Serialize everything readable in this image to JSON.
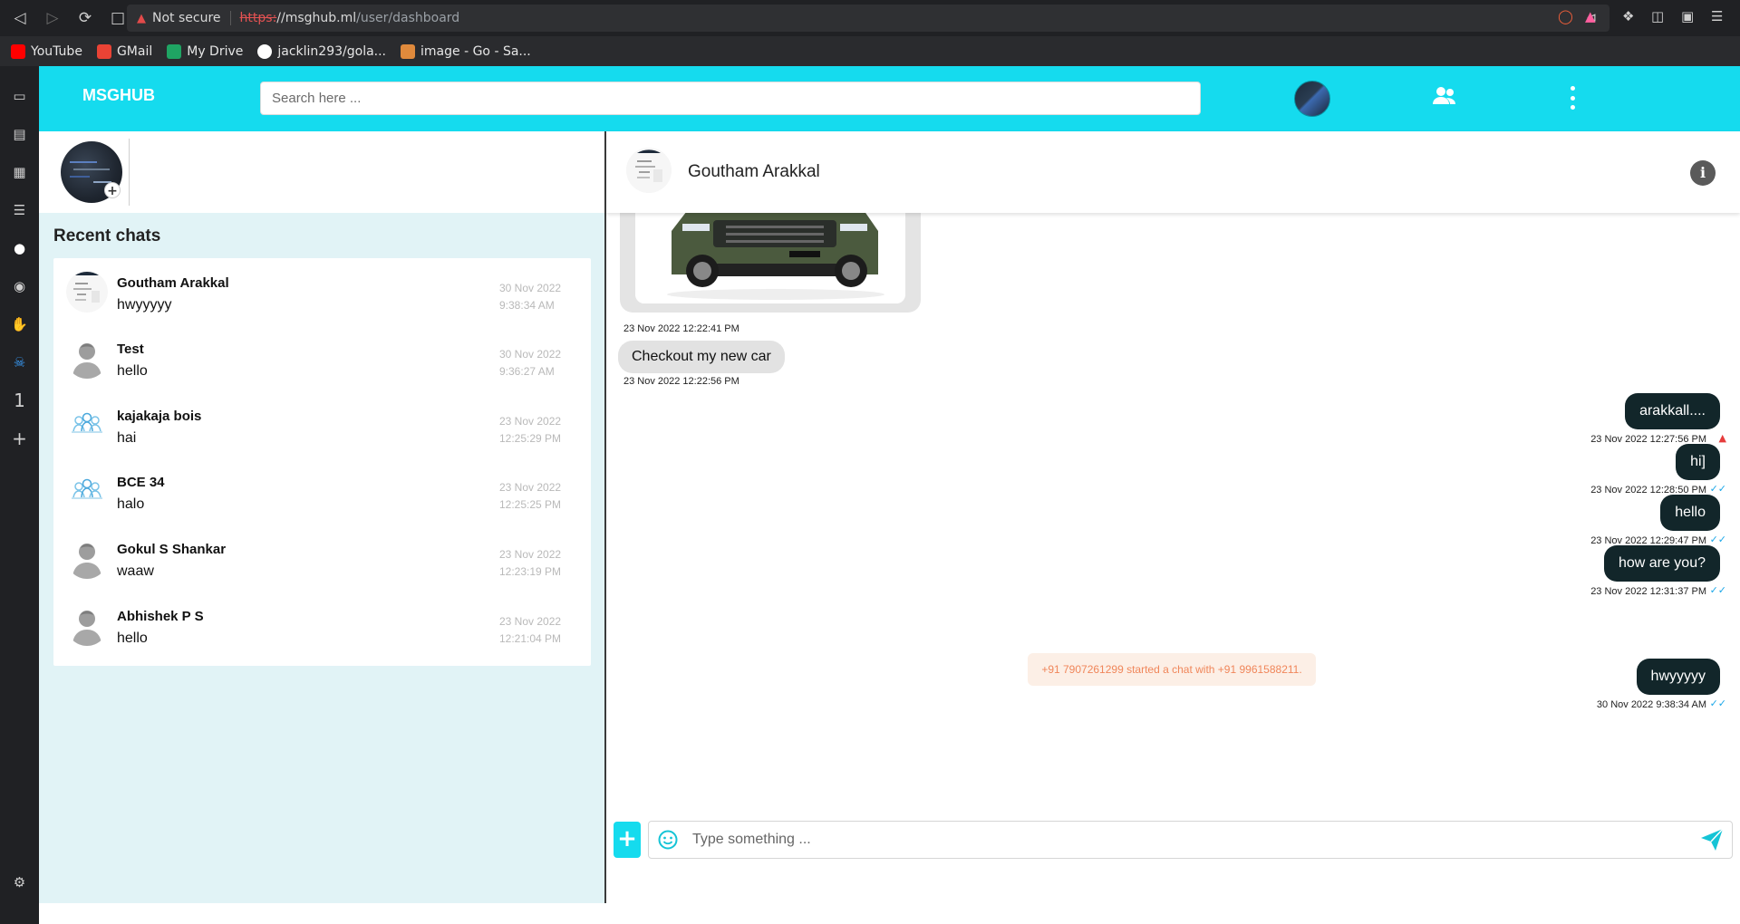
{
  "browser": {
    "warning": "Not secure",
    "url_scheme": "https:",
    "url_host": "//msghub.ml",
    "url_path": "/user/dashboard",
    "bookmarks": [
      {
        "label": "YouTube",
        "color": "#ff0000"
      },
      {
        "label": "GMail",
        "color": "#ea4335"
      },
      {
        "label": "My Drive",
        "color": "#1fa463"
      },
      {
        "label": "jacklin293/gola...",
        "color": "#ffffff"
      },
      {
        "label": "image - Go - Sa...",
        "color": "#e08a3c"
      }
    ]
  },
  "app": {
    "brand": "MSGHUB",
    "search_placeholder": "Search here ...",
    "accent": "#15dbee",
    "recent_title": "Recent chats"
  },
  "chats": [
    {
      "name": "Goutham Arakkal",
      "last": "hwyyyyy",
      "date": "30 Nov 2022",
      "time": "9:38:34 AM",
      "avatar": "screenshot"
    },
    {
      "name": "Test",
      "last": "hello",
      "date": "30 Nov 2022",
      "time": "9:36:27 AM",
      "avatar": "person"
    },
    {
      "name": "kajakaja bois",
      "last": "hai",
      "date": "23 Nov 2022",
      "time": "12:25:29 PM",
      "avatar": "group"
    },
    {
      "name": "BCE 34",
      "last": "halo",
      "date": "23 Nov 2022",
      "time": "12:25:25 PM",
      "avatar": "group"
    },
    {
      "name": "Gokul S Shankar",
      "last": "waaw",
      "date": "23 Nov 2022",
      "time": "12:23:19 PM",
      "avatar": "person"
    },
    {
      "name": "Abhishek P S",
      "last": "hello",
      "date": "23 Nov 2022",
      "time": "12:21:04 PM",
      "avatar": "person"
    }
  ],
  "conversation": {
    "contact": "Goutham Arakkal",
    "image_timestamp": "23 Nov 2022 12:22:41 PM",
    "incoming": [
      {
        "text": "Checkout my new car",
        "timestamp": "23 Nov 2022 12:22:56 PM"
      }
    ],
    "outgoing": [
      {
        "text": "arakkall....",
        "timestamp": "23 Nov 2022 12:27:56 PM",
        "status": "error"
      },
      {
        "text": "hi]",
        "timestamp": "23 Nov 2022 12:28:50 PM",
        "status": "read"
      },
      {
        "text": "hello",
        "timestamp": "23 Nov 2022 12:29:47 PM",
        "status": "read"
      },
      {
        "text": "how are you?",
        "timestamp": "23 Nov 2022 12:31:37 PM",
        "status": "read"
      },
      {
        "text": "hwyyyyy",
        "timestamp": "30 Nov 2022 9:38:34 AM",
        "status": "read"
      }
    ],
    "system_message": "+91 7907261299 started a chat with +91 9961588211."
  },
  "composer": {
    "placeholder": "Type something ..."
  }
}
